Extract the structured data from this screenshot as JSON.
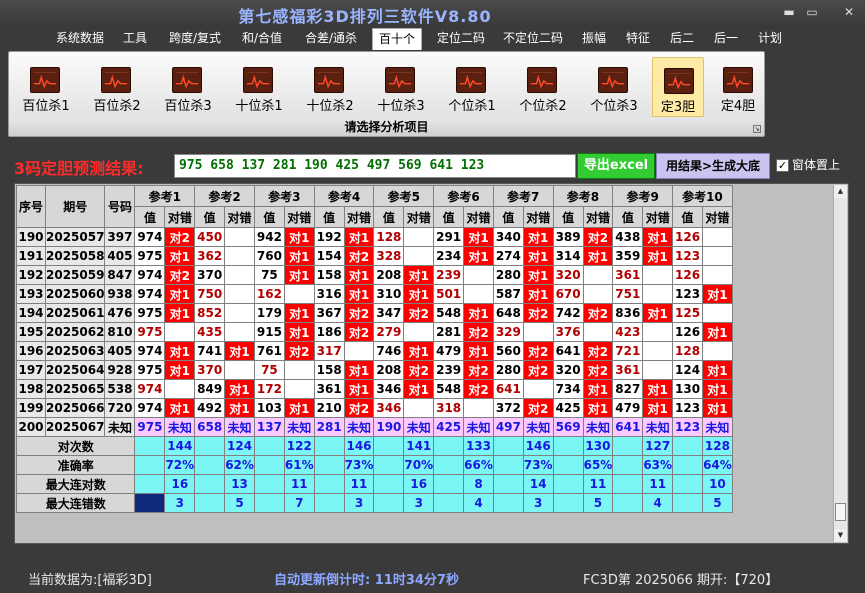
{
  "window": {
    "title": "第七感福彩3D排列三软件V8.80",
    "min": "▬",
    "max": "▭",
    "close": "✕"
  },
  "menu": [
    "系统数据",
    "工具",
    "跨度/复式",
    "和/合值",
    "合差/通杀",
    "百十个",
    "定位二码",
    "不定位二码",
    "振幅",
    "特征",
    "后二",
    "后一",
    "计划"
  ],
  "menu_active": "百十个",
  "ribbon": {
    "buttons": [
      "百位杀1",
      "百位杀2",
      "百位杀3",
      "十位杀1",
      "十位杀2",
      "十位杀3",
      "个位杀1",
      "个位杀2",
      "个位杀3",
      "定3胆",
      "定4胆"
    ],
    "active": "定3胆",
    "caption": "请选择分析项目",
    "icon": "chart-icon"
  },
  "result": {
    "label": "3码定胆预测结果:",
    "value": "975 658 137 281 190 425 497 569 641 123",
    "export_label": "导出excel",
    "generate_label": "用结果>生成大底",
    "ontop_label": "窗体置上",
    "ontop_checked": "✓"
  },
  "table": {
    "headers": {
      "seq": "序号",
      "period": "期号",
      "code": "号码",
      "value": "值",
      "hit": "对错"
    },
    "refs": [
      "参考1",
      "参考2",
      "参考3",
      "参考4",
      "参考5",
      "参考6",
      "参考7",
      "参考8",
      "参考9",
      "参考10"
    ],
    "rows": [
      {
        "seq": "190",
        "period": "2025057",
        "code": "397",
        "cells": [
          [
            "974",
            "对2"
          ],
          [
            "450",
            ""
          ],
          [
            "942",
            "对1"
          ],
          [
            "192",
            "对1"
          ],
          [
            "128",
            ""
          ],
          [
            "291",
            "对1"
          ],
          [
            "340",
            "对1"
          ],
          [
            "389",
            "对2"
          ],
          [
            "438",
            "对1"
          ],
          [
            "126",
            ""
          ]
        ],
        "red": [
          0,
          1,
          0,
          0,
          1,
          0,
          0,
          0,
          0,
          1
        ]
      },
      {
        "seq": "191",
        "period": "2025058",
        "code": "405",
        "cells": [
          [
            "975",
            "对1"
          ],
          [
            "362",
            ""
          ],
          [
            "760",
            "对1"
          ],
          [
            "154",
            "对2"
          ],
          [
            "328",
            ""
          ],
          [
            "234",
            "对1"
          ],
          [
            "274",
            "对1"
          ],
          [
            "314",
            "对1"
          ],
          [
            "359",
            "对1"
          ],
          [
            "123",
            ""
          ]
        ],
        "red": [
          0,
          1,
          0,
          0,
          1,
          0,
          0,
          0,
          0,
          1
        ]
      },
      {
        "seq": "192",
        "period": "2025059",
        "code": "847",
        "cells": [
          [
            "974",
            "对2"
          ],
          [
            "370",
            ""
          ],
          [
            "75",
            "对1"
          ],
          [
            "158",
            "对1"
          ],
          [
            "208",
            "对1"
          ],
          [
            "239",
            ""
          ],
          [
            "280",
            "对1"
          ],
          [
            "320",
            ""
          ],
          [
            "361",
            ""
          ],
          [
            "126",
            ""
          ]
        ],
        "red": [
          0,
          0,
          0,
          0,
          0,
          1,
          0,
          1,
          1,
          1
        ]
      },
      {
        "seq": "193",
        "period": "2025060",
        "code": "938",
        "cells": [
          [
            "974",
            "对1"
          ],
          [
            "750",
            ""
          ],
          [
            "162",
            ""
          ],
          [
            "316",
            "对1"
          ],
          [
            "310",
            "对1"
          ],
          [
            "501",
            ""
          ],
          [
            "587",
            "对1"
          ],
          [
            "670",
            ""
          ],
          [
            "751",
            ""
          ],
          [
            "123",
            "对1"
          ]
        ],
        "red": [
          0,
          1,
          1,
          0,
          0,
          1,
          0,
          1,
          1,
          0
        ]
      },
      {
        "seq": "194",
        "period": "2025061",
        "code": "476",
        "cells": [
          [
            "975",
            "对1"
          ],
          [
            "852",
            ""
          ],
          [
            "179",
            "对1"
          ],
          [
            "367",
            "对2"
          ],
          [
            "347",
            "对2"
          ],
          [
            "548",
            "对1"
          ],
          [
            "648",
            "对2"
          ],
          [
            "742",
            "对2"
          ],
          [
            "836",
            "对1"
          ],
          [
            "125",
            ""
          ]
        ],
        "red": [
          0,
          1,
          0,
          0,
          0,
          0,
          0,
          0,
          0,
          1
        ]
      },
      {
        "seq": "195",
        "period": "2025062",
        "code": "810",
        "cells": [
          [
            "975",
            ""
          ],
          [
            "435",
            ""
          ],
          [
            "915",
            "对1"
          ],
          [
            "186",
            "对2"
          ],
          [
            "279",
            ""
          ],
          [
            "281",
            "对2"
          ],
          [
            "329",
            ""
          ],
          [
            "376",
            ""
          ],
          [
            "423",
            ""
          ],
          [
            "126",
            "对1"
          ]
        ],
        "red": [
          1,
          1,
          0,
          0,
          1,
          0,
          1,
          1,
          1,
          0
        ]
      },
      {
        "seq": "196",
        "period": "2025063",
        "code": "405",
        "cells": [
          [
            "974",
            "对1"
          ],
          [
            "741",
            "对1"
          ],
          [
            "761",
            "对2"
          ],
          [
            "317",
            ""
          ],
          [
            "746",
            "对1"
          ],
          [
            "479",
            "对1"
          ],
          [
            "560",
            "对2"
          ],
          [
            "641",
            "对2"
          ],
          [
            "721",
            ""
          ],
          [
            "128",
            ""
          ]
        ],
        "red": [
          0,
          0,
          0,
          1,
          0,
          0,
          0,
          0,
          1,
          1
        ]
      },
      {
        "seq": "197",
        "period": "2025064",
        "code": "928",
        "cells": [
          [
            "975",
            "对1"
          ],
          [
            "370",
            ""
          ],
          [
            "75",
            ""
          ],
          [
            "158",
            "对1"
          ],
          [
            "208",
            "对2"
          ],
          [
            "239",
            "对2"
          ],
          [
            "280",
            "对2"
          ],
          [
            "320",
            "对2"
          ],
          [
            "361",
            ""
          ],
          [
            "124",
            "对1"
          ]
        ],
        "red": [
          0,
          1,
          1,
          0,
          0,
          0,
          0,
          0,
          1,
          0
        ]
      },
      {
        "seq": "198",
        "period": "2025065",
        "code": "538",
        "cells": [
          [
            "974",
            ""
          ],
          [
            "849",
            "对1"
          ],
          [
            "172",
            ""
          ],
          [
            "361",
            "对1"
          ],
          [
            "346",
            "对1"
          ],
          [
            "548",
            "对2"
          ],
          [
            "641",
            ""
          ],
          [
            "734",
            "对1"
          ],
          [
            "827",
            "对1"
          ],
          [
            "130",
            "对1"
          ]
        ],
        "red": [
          1,
          0,
          1,
          0,
          0,
          0,
          1,
          0,
          0,
          0
        ]
      },
      {
        "seq": "199",
        "period": "2025066",
        "code": "720",
        "cells": [
          [
            "974",
            "对1"
          ],
          [
            "492",
            "对1"
          ],
          [
            "103",
            "对1"
          ],
          [
            "210",
            "对2"
          ],
          [
            "346",
            ""
          ],
          [
            "318",
            ""
          ],
          [
            "372",
            "对2"
          ],
          [
            "425",
            "对1"
          ],
          [
            "479",
            "对1"
          ],
          [
            "123",
            "对1"
          ]
        ],
        "red": [
          0,
          0,
          0,
          0,
          1,
          1,
          0,
          0,
          0,
          0
        ]
      }
    ],
    "prediction": {
      "seq": "200",
      "period": "2025067",
      "code": "未知",
      "cells": [
        [
          "975",
          "未知"
        ],
        [
          "658",
          "未知"
        ],
        [
          "137",
          "未知"
        ],
        [
          "281",
          "未知"
        ],
        [
          "190",
          "未知"
        ],
        [
          "425",
          "未知"
        ],
        [
          "497",
          "未知"
        ],
        [
          "569",
          "未知"
        ],
        [
          "641",
          "未知"
        ],
        [
          "123",
          "未知"
        ]
      ]
    },
    "stats": [
      {
        "label": "对次数",
        "values": [
          "144",
          "124",
          "122",
          "146",
          "141",
          "133",
          "146",
          "130",
          "127",
          "128"
        ]
      },
      {
        "label": "准确率",
        "values": [
          "72%",
          "62%",
          "61%",
          "73%",
          "70%",
          "66%",
          "73%",
          "65%",
          "63%",
          "64%"
        ]
      },
      {
        "label": "最大连对数",
        "values": [
          "16",
          "13",
          "11",
          "11",
          "16",
          "8",
          "14",
          "11",
          "11",
          "10"
        ]
      },
      {
        "label": "最大连错数",
        "values": [
          "3",
          "5",
          "7",
          "3",
          "3",
          "4",
          "3",
          "5",
          "4",
          "5"
        ]
      }
    ]
  },
  "status": {
    "left": "当前数据为:[福彩3D]",
    "mid": "自动更新倒计时:  11时34分7秒",
    "right": "FC3D第 2025066 期开:【720】"
  },
  "colors": {
    "hit": "#ff0000",
    "miss_text": "#b00000",
    "stat_bg": "#7cf5f5",
    "prediction_bg": "#ffc8ff",
    "accent_text": "#1818e0"
  }
}
